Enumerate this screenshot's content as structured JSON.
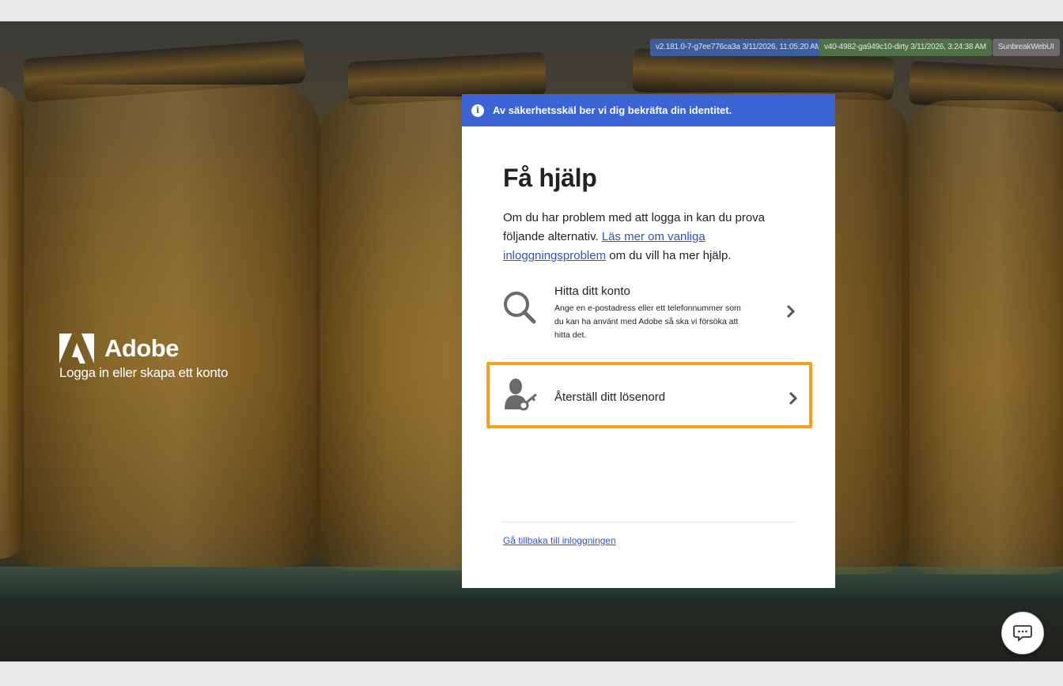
{
  "build_badges": [
    "v2.181.0-7-g7ee776ca3a 3/11/2026, 11:05:20 AM",
    "v40-4982-ga949c10-dirty 3/11/2026, 3:24:38 AM",
    "SunbreakWebUI"
  ],
  "brand": {
    "name": "Adobe",
    "tagline": "Logga in eller skapa ett konto"
  },
  "banner": {
    "icon": "info-icon",
    "text": "Av säkerhetsskäl ber vi dig bekräfta din identitet."
  },
  "card": {
    "title": "Få hjälp",
    "intro_before_link": "Om du har problem med att logga in kan du prova följande alternativ. ",
    "intro_link": "Läs mer om vanliga inloggningsproblem",
    "intro_after_link": " om du vill ha mer hjälp.",
    "options": [
      {
        "icon": "search-icon",
        "title": "Hitta ditt konto",
        "description": "Ange en e-postadress eller ett telefonnummer som du kan ha använt med Adobe så ska vi försöka att hitta det."
      },
      {
        "icon": "user-key-icon",
        "title": "Återställ ditt lösenord",
        "highlighted": true
      }
    ],
    "back_link": "Gå tillbaka till inloggningen"
  },
  "colors": {
    "banner": "#3b63d4",
    "link": "#2c55c9",
    "highlight": "#f5a11a"
  },
  "chat_button": {
    "icon": "chat-icon"
  }
}
